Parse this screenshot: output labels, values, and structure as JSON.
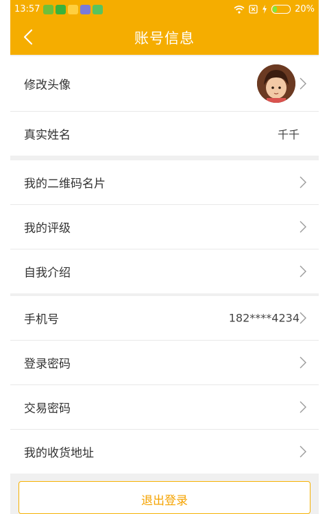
{
  "status_bar": {
    "time": "13:57",
    "battery": "20%",
    "app_icons": [
      "app-icon-green",
      "wechat-icon",
      "app-icon-yellow",
      "app-icon-purple",
      "app-icon-robot"
    ]
  },
  "nav": {
    "title": "账号信息",
    "back_icon": "chevron-left-icon"
  },
  "sections": [
    {
      "rows": [
        {
          "label": "修改头像",
          "value": "",
          "avatar": true,
          "arrow": true
        },
        {
          "label": "真实姓名",
          "value": "千千",
          "arrow": false
        }
      ]
    },
    {
      "rows": [
        {
          "label": "我的二维码名片",
          "value": "",
          "arrow": true
        },
        {
          "label": "我的评级",
          "value": "",
          "arrow": true
        },
        {
          "label": "自我介绍",
          "value": "",
          "arrow": true
        }
      ]
    },
    {
      "rows": [
        {
          "label": "手机号",
          "value": "182****4234",
          "arrow": true
        },
        {
          "label": "登录密码",
          "value": "",
          "arrow": true
        },
        {
          "label": "交易密码",
          "value": "",
          "arrow": true
        },
        {
          "label": "我的收货地址",
          "value": "",
          "arrow": true
        }
      ]
    }
  ],
  "logout": {
    "label": "退出登录"
  },
  "colors": {
    "accent": "#f5ad00",
    "background": "#f0f0f0",
    "row_text": "#333333",
    "divider": "#e8e8e8"
  }
}
